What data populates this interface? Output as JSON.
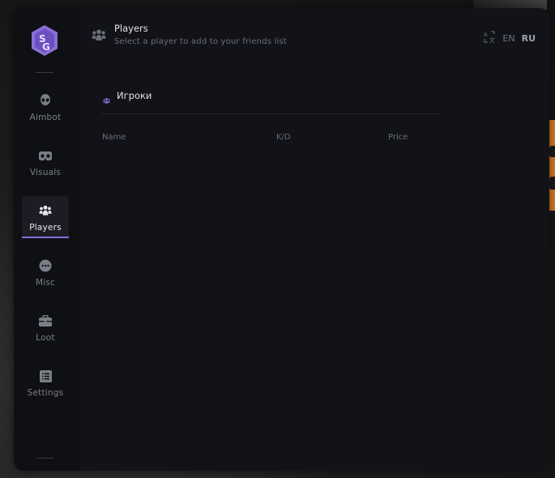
{
  "header": {
    "title": "Players",
    "subtitle": "Select a player to add to your friends list"
  },
  "language": {
    "options": [
      "EN",
      "RU"
    ],
    "active": "RU"
  },
  "sidebar": {
    "items": [
      {
        "label": "Aimbot",
        "icon": "alien-icon"
      },
      {
        "label": "Visuals",
        "icon": "vr-headset-icon"
      },
      {
        "label": "Players",
        "icon": "users-icon",
        "active": true
      },
      {
        "label": "Misc",
        "icon": "chat-dots-icon"
      },
      {
        "label": "Loot",
        "icon": "briefcase-icon"
      },
      {
        "label": "Settings",
        "icon": "list-icon"
      }
    ]
  },
  "section": {
    "title": "Игроки"
  },
  "table": {
    "columns": [
      "Name",
      "K/D",
      "Price"
    ],
    "rows": []
  },
  "colors": {
    "accent": "#8b6fd6",
    "background": "#121318",
    "sidebar": "#0f1014"
  }
}
